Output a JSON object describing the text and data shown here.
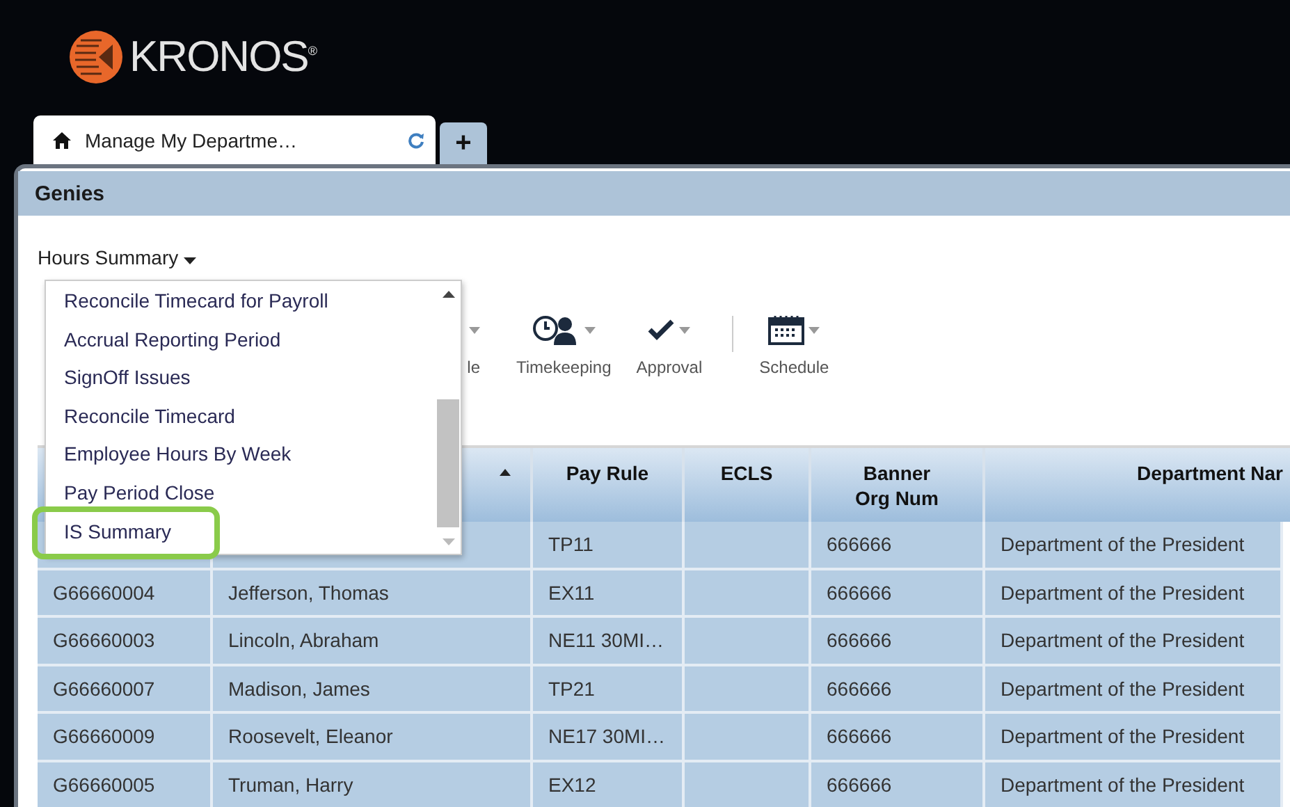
{
  "brand": {
    "logo_text": "KRONOS$^{®}$"
  },
  "tabs": [
    {
      "kind": "page",
      "label": "Manage My Departme…",
      "selected": true
    },
    {
      "kind": "add",
      "label": "+",
      "selected": false
    }
  ],
  "panel": {
    "title": "Genies"
  },
  "genie_selector": {
    "label": "Hours Summary"
  },
  "toolbar": [
    {
      "kind": "partial",
      "label": "le"
    },
    {
      "kind": "timekeeping",
      "label": "Timekeeping"
    },
    {
      "kind": "approval",
      "label": "Approval"
    },
    {
      "kind": "separator"
    },
    {
      "kind": "schedule",
      "label": "Schedule"
    }
  ],
  "table": {
    "columns": [
      {},
      {
        "sorted": true
      },
      {
        "label": "Pay Rule"
      },
      {
        "label": "ECLS"
      },
      {
        "label": "Banner\nOrg Num"
      },
      {
        "label": "Department Nar"
      }
    ],
    "rows": [
      {
        "pay_rule": "TP11",
        "org_num": "666666",
        "department": "Department of the President"
      },
      {
        "id": "G66660004",
        "name": "Jefferson, Thomas",
        "pay_rule": "EX11",
        "org_num": "666666",
        "department": "Department of the President"
      },
      {
        "id": "G66660003",
        "name": "Lincoln, Abraham",
        "pay_rule": "NE11 30MI…",
        "org_num": "666666",
        "department": "Department of the President"
      },
      {
        "id": "G66660007",
        "name": "Madison, James",
        "pay_rule": "TP21",
        "org_num": "666666",
        "department": "Department of the President"
      },
      {
        "id": "G66660009",
        "name": "Roosevelt, Eleanor",
        "pay_rule": "NE17 30MI…",
        "org_num": "666666",
        "department": "Department of the President"
      },
      {
        "id": "G66660005",
        "name": "Truman, Harry",
        "pay_rule": "EX12",
        "org_num": "666666",
        "department": "Department of the President"
      }
    ]
  },
  "dropdown": {
    "items": [
      {
        "label": "Reconcile Timecard for Payroll",
        "annotated": false
      },
      {
        "label": "Accrual Reporting Period",
        "annotated": false
      },
      {
        "label": "SignOff Issues",
        "annotated": false
      },
      {
        "label": "Reconcile Timecard",
        "annotated": false
      },
      {
        "label": "Employee Hours By Week",
        "annotated": false
      },
      {
        "label": "Pay Period Close",
        "annotated": false
      },
      {
        "label": "IS Summary",
        "annotated": true
      }
    ]
  }
}
